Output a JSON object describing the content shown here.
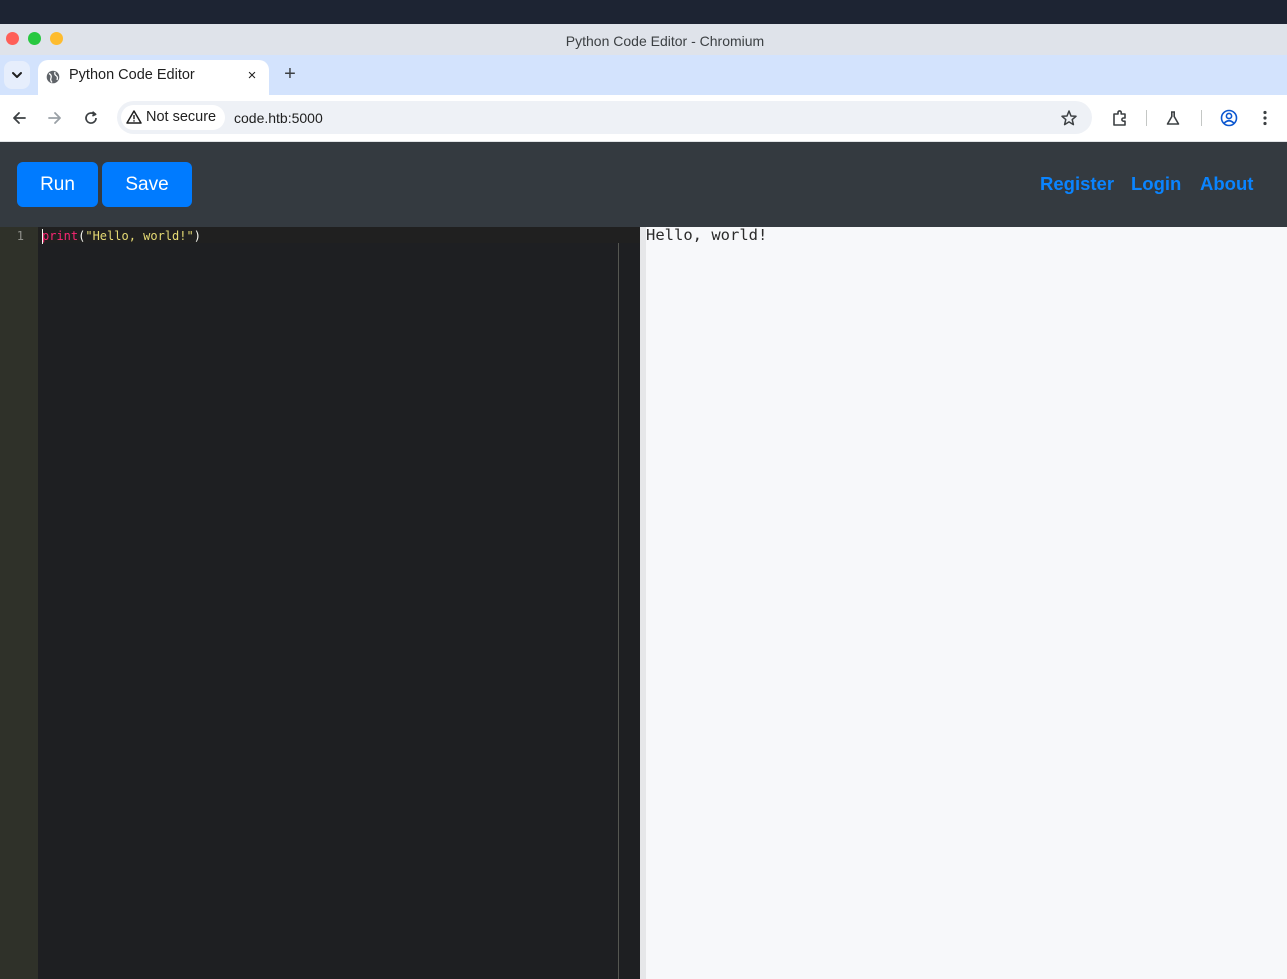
{
  "window": {
    "title": "Python Code Editor - Chromium"
  },
  "tab": {
    "title": "Python Code Editor",
    "close_glyph": "×",
    "new_tab_glyph": "+"
  },
  "address_bar": {
    "security_label": "Not secure",
    "url": "code.htb:5000"
  },
  "app": {
    "buttons": {
      "run": "Run",
      "save": "Save"
    },
    "nav": {
      "register": "Register",
      "login": "Login",
      "about": "About"
    }
  },
  "editor": {
    "line_numbers": [
      "1"
    ],
    "code": {
      "fn": "print",
      "open": "(",
      "string": "\"Hello, world!\"",
      "close": ")"
    }
  },
  "output": {
    "text": "Hello, world!"
  },
  "colors": {
    "accent_button": "#007bff",
    "nav_link": "#0a84ff",
    "app_header": "#343a40",
    "editor_bg": "#1e1f22",
    "output_bg": "#f7f8fa"
  },
  "icons": [
    "tab-list-icon",
    "globe-icon",
    "close-icon",
    "plus-icon",
    "back-arrow-icon",
    "forward-arrow-icon",
    "reload-icon",
    "warning-triangle-icon",
    "star-icon",
    "extensions-icon",
    "labs-flask-icon",
    "profile-icon",
    "more-vert-icon"
  ]
}
